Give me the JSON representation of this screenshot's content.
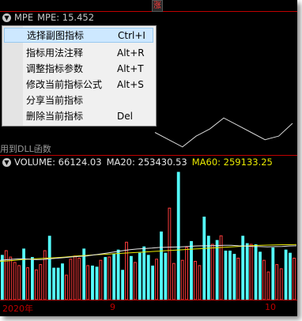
{
  "top_badge": "涨",
  "mpe_panel": {
    "title": "MPE",
    "value_label": "MPE: 15.452",
    "chart_data": {
      "type": "line",
      "values": [
        15.2,
        15.0,
        14.8,
        15.1,
        15.3,
        15.6,
        15.4,
        15.2,
        15.0,
        15.1,
        15.452
      ]
    }
  },
  "context_menu": {
    "items": [
      {
        "label": "选择副图指标",
        "shortcut": "Ctrl+I"
      },
      {
        "label": "指标用法注释",
        "shortcut": "Alt+R"
      },
      {
        "label": "调整指标参数",
        "shortcut": "Alt+T"
      },
      {
        "label": "修改当前指标公式",
        "shortcut": "Alt+S"
      },
      {
        "label": "分享当前指标",
        "shortcut": ""
      },
      {
        "label": "删除当前指标",
        "shortcut": "Del"
      }
    ]
  },
  "dll_text": "用到DLL函数",
  "volume_panel": {
    "volume_label": "VOLUME: 66124.03",
    "ma20_label": "MA20: 253430.53",
    "ma60_label": "MA60: 259133.25",
    "colors": {
      "up": "#ff3b3b",
      "down": "#54ffff",
      "ma20": "#e6e6e6",
      "ma60": "#e8e800"
    },
    "chart_data": {
      "type": "bar",
      "volumes": [
        210,
        230,
        200,
        175,
        160,
        240,
        150,
        200,
        140,
        165,
        230,
        300,
        150,
        150,
        170,
        115,
        190,
        205,
        195,
        240,
        160,
        160,
        155,
        185,
        200,
        200,
        215,
        235,
        140,
        270,
        205,
        175,
        220,
        250,
        210,
        160,
        190,
        320,
        220,
        430,
        170,
        600,
        185,
        245,
        275,
        180,
        160,
        390,
        300,
        260,
        280,
        300,
        230,
        230,
        215,
        195,
        300,
        265,
        260,
        260,
        225,
        185,
        130,
        245,
        165,
        145,
        235,
        220,
        195
      ],
      "up": [
        0,
        1,
        1,
        1,
        1,
        0,
        1,
        0,
        1,
        1,
        1,
        0,
        0,
        0,
        0,
        1,
        1,
        1,
        1,
        0,
        1,
        0,
        0,
        1,
        0,
        1,
        0,
        0,
        0,
        1,
        0,
        1,
        0,
        0,
        0,
        0,
        1,
        0,
        0,
        1,
        1,
        0,
        1,
        1,
        0,
        1,
        1,
        0,
        0,
        1,
        0,
        1,
        0,
        0,
        0,
        1,
        0,
        0,
        1,
        0,
        0,
        1,
        1,
        0,
        1,
        1,
        0,
        0,
        1
      ],
      "ma20": [
        185,
        188,
        190,
        192,
        190,
        188,
        189,
        192,
        195,
        198,
        201,
        203,
        205,
        210,
        215,
        220,
        225,
        230,
        235,
        238,
        240,
        242,
        245,
        246,
        247,
        248,
        250,
        252,
        253,
        253,
        254,
        255,
        255,
        253,
        252,
        250,
        249,
        248,
        249,
        250,
        252,
        253
      ],
      "ma60": [
        180,
        182,
        185,
        188,
        190,
        192,
        194,
        196,
        198,
        200,
        203,
        206,
        208,
        210,
        212,
        214,
        216,
        218,
        220,
        222,
        224,
        226,
        228,
        230,
        232,
        234,
        236,
        238,
        240,
        242,
        244,
        246,
        248,
        250,
        252,
        254,
        255,
        256,
        257,
        258,
        258,
        259
      ]
    }
  },
  "date_axis": {
    "labels": [
      "2020年",
      "9",
      "10"
    ]
  }
}
